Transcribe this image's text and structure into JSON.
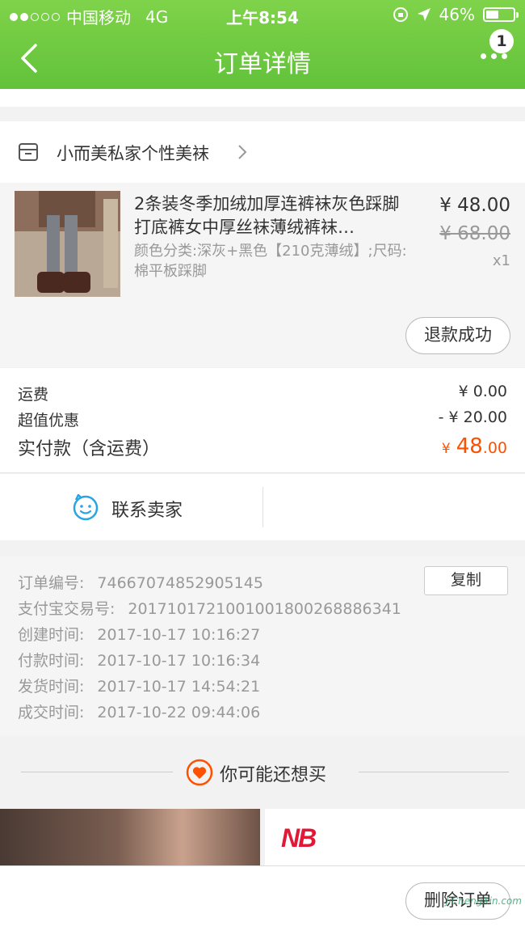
{
  "status_bar": {
    "carrier": "中国移动",
    "network": "4G",
    "time": "上午8:54",
    "battery": "46%",
    "battery_level": 0.46
  },
  "nav": {
    "title": "订单详情",
    "badge_count": "1"
  },
  "shop": {
    "name": "小而美私家个性美袜"
  },
  "product": {
    "title": "2条装冬季加绒加厚连裤袜灰色踩脚打底裤女中厚丝袜薄绒裤袜…",
    "attributes": "颜色分类:深灰+黑色【210克薄绒】;尺码:棉平板踩脚",
    "price": "¥ 48.00",
    "original_price": "¥ 68.00",
    "quantity": "x1",
    "status_button": "退款成功"
  },
  "totals": {
    "shipping_label": "运费",
    "shipping_value": "¥ 0.00",
    "discount_label": "超值优惠",
    "discount_value": "- ¥ 20.00",
    "paid_label": "实付款（含运费）",
    "paid_currency": "¥",
    "paid_int": "48",
    "paid_dec": ".00"
  },
  "contact": {
    "label": "联系卖家"
  },
  "order_info": {
    "copy_button": "复制",
    "rows": [
      {
        "label": "订单编号:",
        "value": "74667074852905145"
      },
      {
        "label": "支付宝交易号:",
        "value": "2017101721001001800268886341"
      },
      {
        "label": "创建时间:",
        "value": "2017-10-17 10:16:27"
      },
      {
        "label": "付款时间:",
        "value": "2017-10-17 10:16:34"
      },
      {
        "label": "发货时间:",
        "value": "2017-10-17 14:54:21"
      },
      {
        "label": "成交时间:",
        "value": "2017-10-22 09:44:06"
      }
    ]
  },
  "recommend": {
    "title": "你可能还想买",
    "brand_logo_text": "NB"
  },
  "bottom": {
    "delete_button": "删除订单",
    "watermark": "JiChengXin.com"
  },
  "colors": {
    "brand_green": "#62c23a",
    "accent_orange": "#ff5000",
    "contact_blue": "#2aa5e3",
    "nb_red": "#e21837"
  }
}
